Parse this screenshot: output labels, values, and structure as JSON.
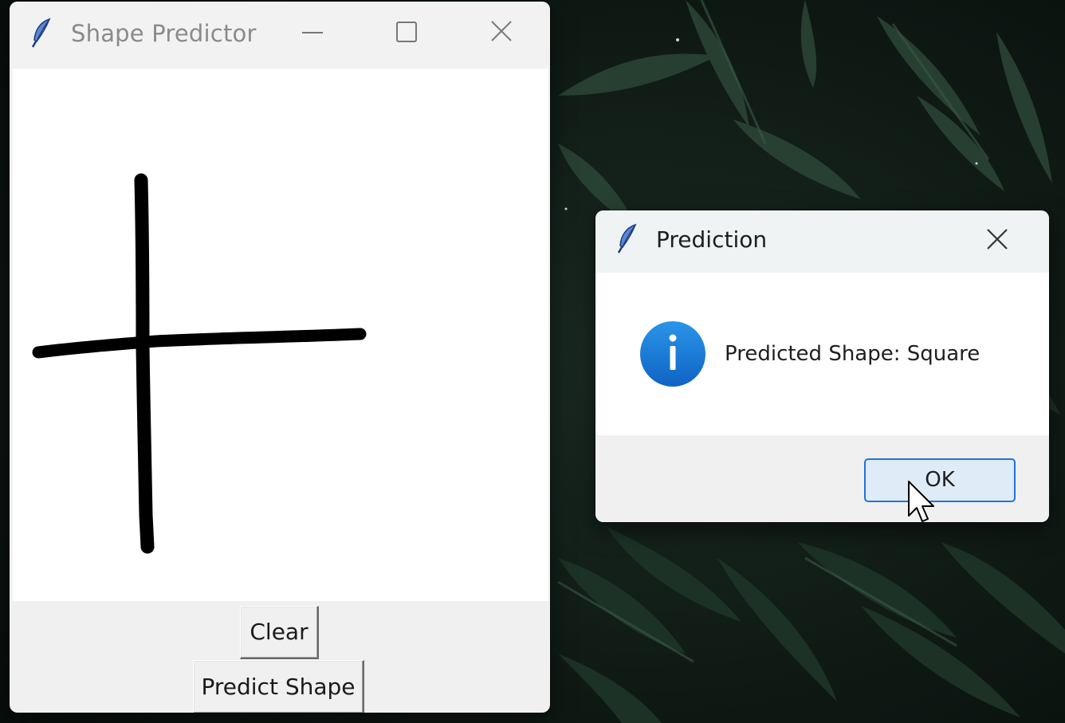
{
  "main_window": {
    "title": "Shape Predictor",
    "title_icon": "feather-icon",
    "controls": [
      "minimize-icon",
      "maximize-icon",
      "close-icon"
    ],
    "clear_label": "Clear",
    "predict_label": "Predict Shape"
  },
  "dialog": {
    "title": "Prediction",
    "title_icon": "feather-icon",
    "icon": "info-icon",
    "message": "Predicted Shape: Square",
    "ok_label": "OK"
  },
  "colors": {
    "accent": "#1f74e0",
    "info_blue": "#1e7fd8",
    "stroke": "#000000"
  }
}
